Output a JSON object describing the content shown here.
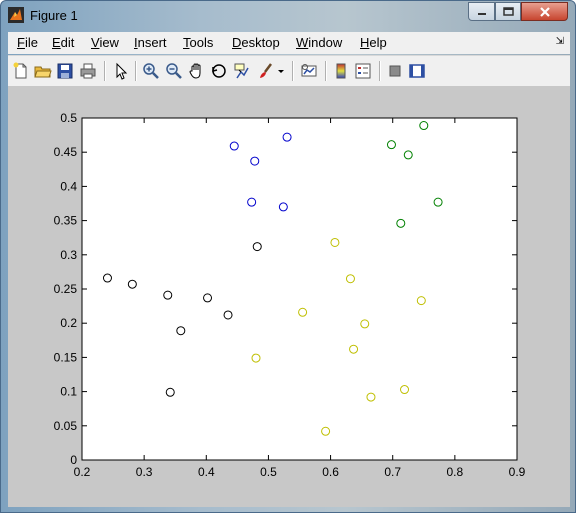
{
  "window": {
    "title": "Figure 1"
  },
  "menubar": {
    "items": [
      {
        "label": "File",
        "accel": "F",
        "rest": "ile"
      },
      {
        "label": "Edit",
        "accel": "E",
        "rest": "dit"
      },
      {
        "label": "View",
        "accel": "V",
        "rest": "iew"
      },
      {
        "label": "Insert",
        "accel": "I",
        "rest": "nsert"
      },
      {
        "label": "Tools",
        "accel": "T",
        "rest": "ools"
      },
      {
        "label": "Desktop",
        "accel": "D",
        "rest": "esktop"
      },
      {
        "label": "Window",
        "accel": "W",
        "rest": "indow"
      },
      {
        "label": "Help",
        "accel": "H",
        "rest": "elp"
      }
    ]
  },
  "toolbar": {
    "icons": [
      "new-figure-icon",
      "open-file-icon",
      "save-icon",
      "print-icon",
      "pointer-icon",
      "zoom-in-icon",
      "zoom-out-icon",
      "pan-hand-icon",
      "rotate-3d-icon",
      "data-cursor-icon",
      "brush-icon",
      "brush-dropdown-icon",
      "link-plot-icon",
      "colorbar-icon",
      "legend-icon",
      "hide-plot-tools-icon",
      "show-plot-tools-icon"
    ]
  },
  "colors": {
    "black": "#000000",
    "blue": "#0000cc",
    "green": "#008000",
    "yellow": "#bfbf00"
  },
  "chart_data": {
    "type": "scatter",
    "title": "",
    "xlabel": "",
    "ylabel": "",
    "xlim": [
      0.2,
      0.9
    ],
    "ylim": [
      0,
      0.5
    ],
    "xticks": [
      "0.2",
      "0.3",
      "0.4",
      "0.5",
      "0.6",
      "0.7",
      "0.8",
      "0.9"
    ],
    "yticks": [
      "0",
      "0.05",
      "0.1",
      "0.15",
      "0.2",
      "0.25",
      "0.3",
      "0.35",
      "0.4",
      "0.45",
      "0.5"
    ],
    "marker": "circle-open",
    "grid": false,
    "series": [
      {
        "color": "#000000",
        "points": [
          [
            0.241,
            0.266
          ],
          [
            0.281,
            0.257
          ],
          [
            0.338,
            0.241
          ],
          [
            0.402,
            0.237
          ],
          [
            0.359,
            0.189
          ],
          [
            0.435,
            0.212
          ],
          [
            0.482,
            0.312
          ],
          [
            0.342,
            0.099
          ]
        ]
      },
      {
        "color": "#0000cc",
        "points": [
          [
            0.445,
            0.459
          ],
          [
            0.53,
            0.472
          ],
          [
            0.478,
            0.437
          ],
          [
            0.473,
            0.377
          ],
          [
            0.524,
            0.37
          ]
        ]
      },
      {
        "color": "#008000",
        "points": [
          [
            0.75,
            0.489
          ],
          [
            0.698,
            0.461
          ],
          [
            0.725,
            0.446
          ],
          [
            0.773,
            0.377
          ],
          [
            0.713,
            0.346
          ]
        ]
      },
      {
        "color": "#bfbf00",
        "points": [
          [
            0.607,
            0.318
          ],
          [
            0.632,
            0.265
          ],
          [
            0.746,
            0.233
          ],
          [
            0.555,
            0.216
          ],
          [
            0.655,
            0.199
          ],
          [
            0.637,
            0.162
          ],
          [
            0.48,
            0.149
          ],
          [
            0.719,
            0.103
          ],
          [
            0.665,
            0.092
          ],
          [
            0.592,
            0.042
          ]
        ]
      }
    ]
  }
}
